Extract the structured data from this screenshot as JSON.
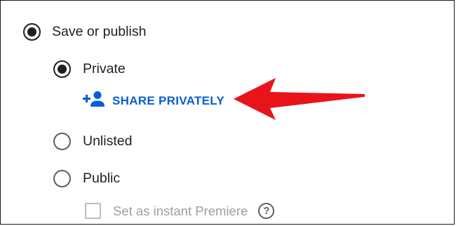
{
  "visibility": {
    "save_or_publish": {
      "label": "Save or publish",
      "selected": true
    },
    "options": [
      {
        "label": "Private",
        "selected": true
      },
      {
        "label": "Unlisted",
        "selected": false
      },
      {
        "label": "Public",
        "selected": false
      }
    ],
    "share_privately": {
      "label": "SHARE PRIVATELY",
      "icon": "add-person-icon"
    },
    "premiere": {
      "label": "Set as instant Premiere",
      "checked": false,
      "enabled": false,
      "help_icon": "help-circle-icon"
    }
  },
  "colors": {
    "link": "#065fd4",
    "annotation_arrow": "#e8141a"
  },
  "annotation": {
    "icon": "red-arrow-pointer",
    "target": "share-privately-link"
  }
}
